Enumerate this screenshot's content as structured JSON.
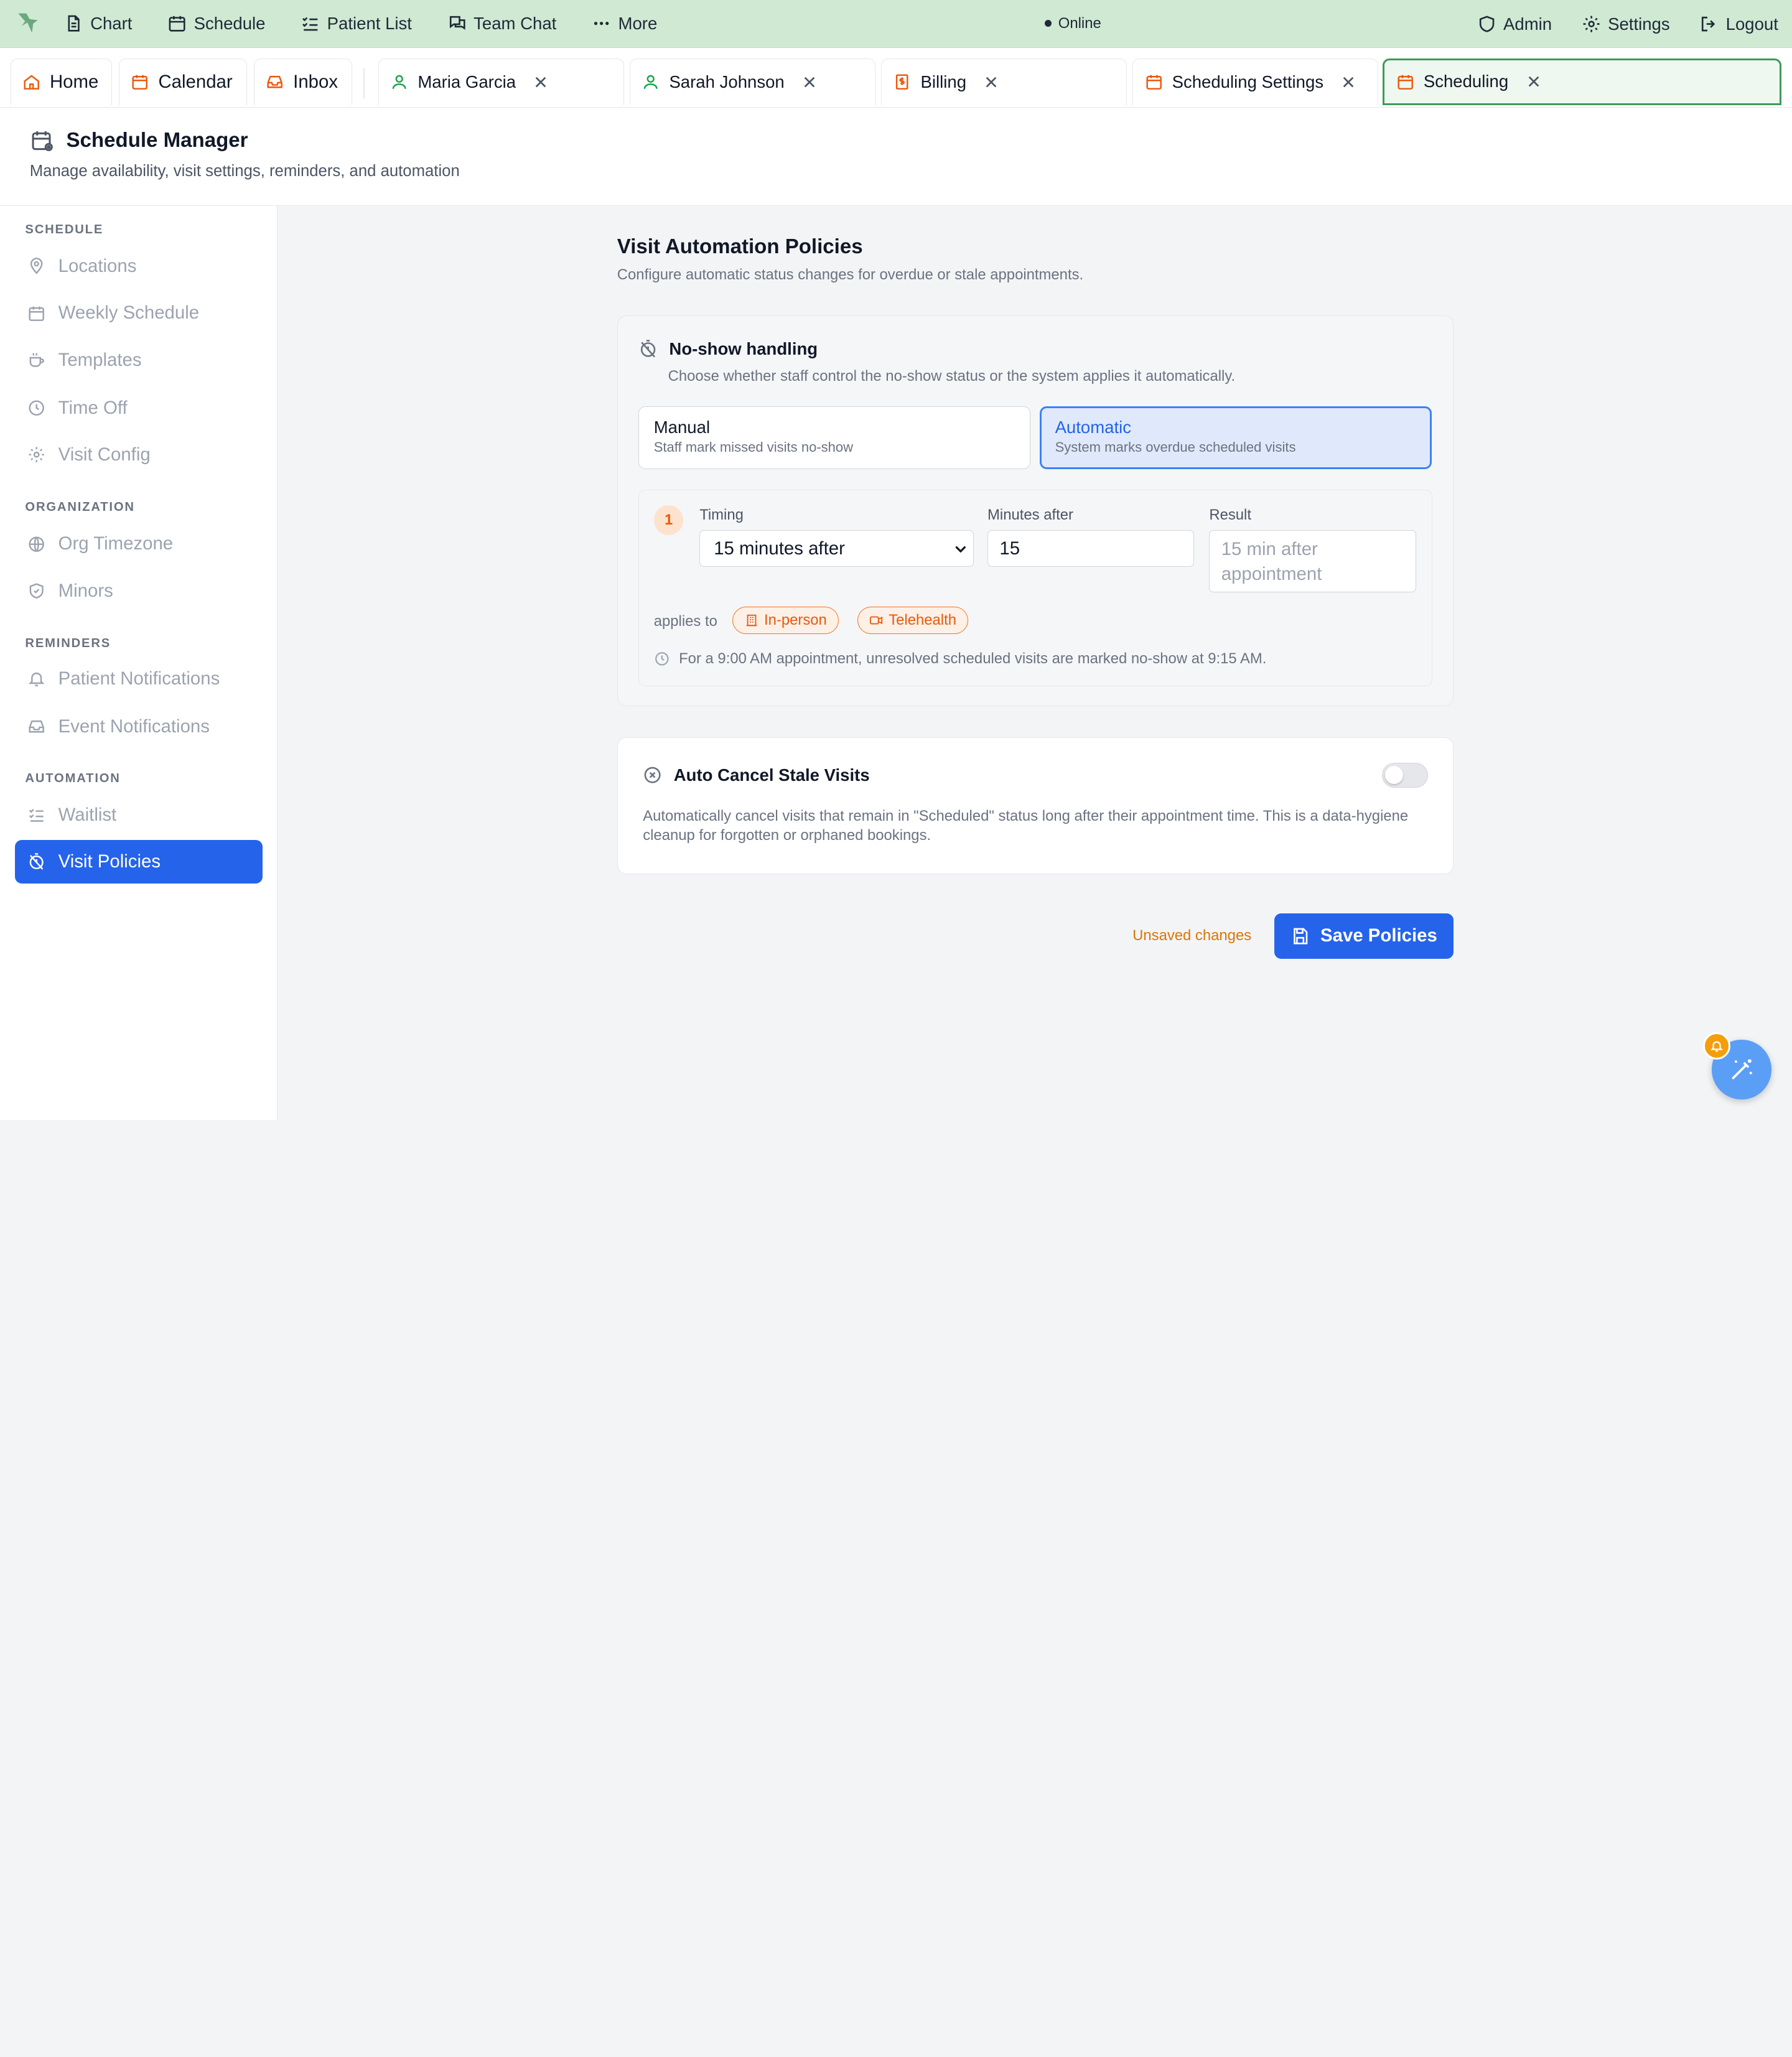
{
  "topnav": {
    "items": [
      {
        "label": "Chart",
        "icon": "file-text-icon"
      },
      {
        "label": "Schedule",
        "icon": "calendar-icon"
      },
      {
        "label": "Patient List",
        "icon": "list-check-icon"
      },
      {
        "label": "Team Chat",
        "icon": "messages-icon"
      },
      {
        "label": "More",
        "icon": "ellipsis-icon"
      }
    ],
    "status": "Online",
    "right": [
      {
        "label": "Admin",
        "icon": "shield-icon"
      },
      {
        "label": "Settings",
        "icon": "gear-icon"
      },
      {
        "label": "Logout",
        "icon": "logout-icon"
      }
    ]
  },
  "tabs": [
    {
      "label": "Home",
      "icon": "home-icon",
      "closable": false
    },
    {
      "label": "Calendar",
      "icon": "calendar-icon",
      "closable": false
    },
    {
      "label": "Inbox",
      "icon": "inbox-icon",
      "closable": false
    },
    {
      "label": "Maria Garcia",
      "icon": "user-icon",
      "closable": true
    },
    {
      "label": "Sarah Johnson",
      "icon": "user-icon",
      "closable": true
    },
    {
      "label": "Billing",
      "icon": "dollar-doc-icon",
      "closable": true
    },
    {
      "label": "Scheduling Settings",
      "icon": "calendar-icon",
      "closable": true
    },
    {
      "label": "Scheduling",
      "icon": "calendar-icon",
      "closable": true,
      "active": true
    }
  ],
  "header": {
    "title": "Schedule Manager",
    "subtitle": "Manage availability, visit settings, reminders, and automation"
  },
  "sidebar": {
    "sections": [
      {
        "title": "SCHEDULE",
        "items": [
          "Locations",
          "Weekly Schedule",
          "Templates",
          "Time Off",
          "Visit Config"
        ]
      },
      {
        "title": "ORGANIZATION",
        "items": [
          "Org Timezone",
          "Minors"
        ]
      },
      {
        "title": "REMINDERS",
        "items": [
          "Patient Notifications",
          "Event Notifications"
        ]
      },
      {
        "title": "AUTOMATION",
        "items": [
          "Waitlist",
          "Visit Policies"
        ]
      }
    ],
    "active": "Visit Policies"
  },
  "main": {
    "title": "Visit Automation Policies",
    "subtitle": "Configure automatic status changes for overdue or stale appointments.",
    "noshow": {
      "title": "No-show handling",
      "subtitle": "Choose whether staff control the no-show status or the system applies it automatically.",
      "options": [
        {
          "title": "Manual",
          "desc": "Staff mark missed visits no-show",
          "selected": false
        },
        {
          "title": "Automatic",
          "desc": "System marks overdue scheduled visits",
          "selected": true
        }
      ],
      "rule": {
        "number": "1",
        "timing_label": "Timing",
        "timing_value": "15 minutes after",
        "minutes_label": "Minutes after",
        "minutes_value": "15",
        "result_label": "Result",
        "result_value": "15 min after appointment",
        "applies_label": "applies to",
        "chips": [
          "In-person",
          "Telehealth"
        ],
        "note": "For a 9:00 AM appointment, unresolved scheduled visits are marked no-show at 9:15 AM."
      }
    },
    "autocancel": {
      "title": "Auto Cancel Stale Visits",
      "enabled": false,
      "description": "Automatically cancel visits that remain in \"Scheduled\" status long after their appointment time. This is a data-hygiene cleanup for forgotten or orphaned bookings."
    },
    "unsaved": "Unsaved changes",
    "save_label": "Save Policies"
  },
  "colors": {
    "topbar": "#cfe9d3",
    "accent": "#2563eb",
    "orange": "#ea580c",
    "active_tab_border": "#3f9a5a"
  }
}
